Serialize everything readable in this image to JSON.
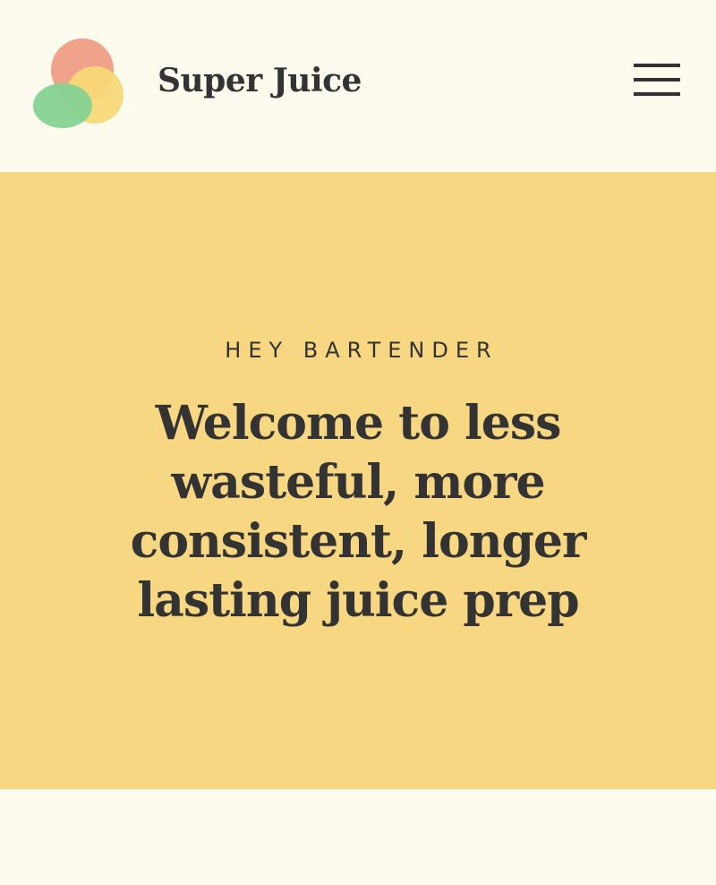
{
  "header": {
    "brand_name": "Super Juice",
    "logo_icon": "citrus-circles-logo",
    "menu_icon": "hamburger-menu-icon"
  },
  "hero": {
    "eyebrow": "HEY BARTENDER",
    "headline": "Welcome to less wasteful, more consistent, longer lasting juice prep"
  },
  "colors": {
    "page_background": "#fdfaee",
    "hero_background": "#f7d782",
    "text": "#333333",
    "logo_red": "#f1a28a",
    "logo_yellow": "#f8d878",
    "logo_green": "#86d393"
  }
}
